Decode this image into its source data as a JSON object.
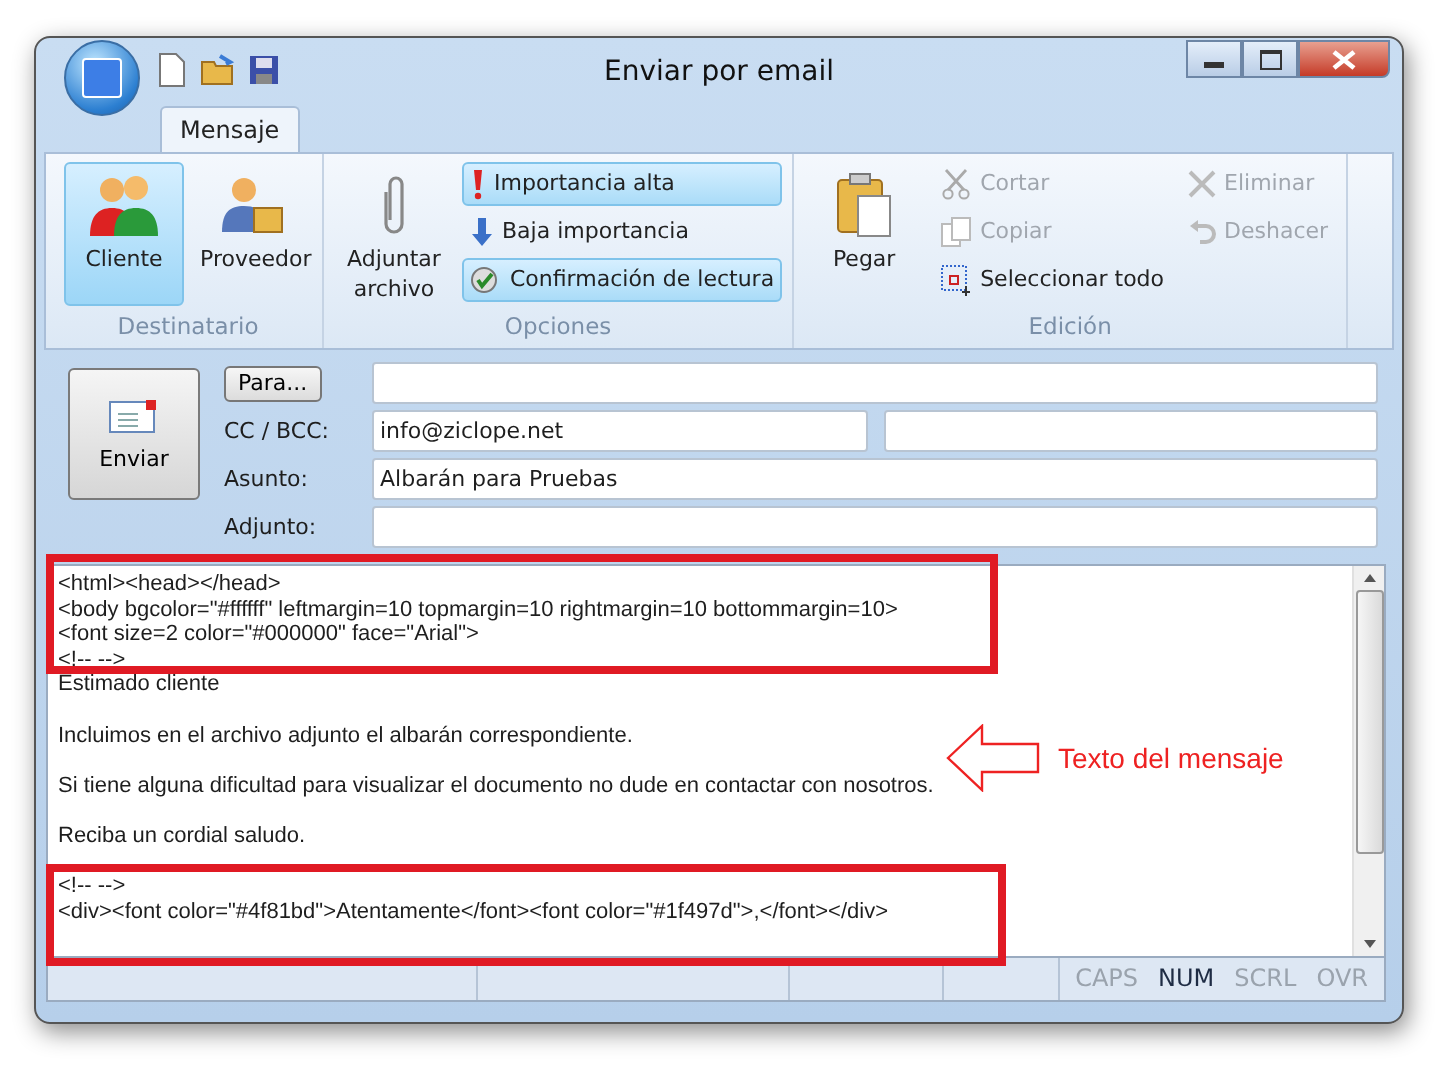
{
  "window": {
    "title": "Enviar por email"
  },
  "tabs": [
    {
      "label": "Mensaje",
      "selected": true
    }
  ],
  "ribbon": {
    "groups": [
      {
        "label": "Destinatario",
        "items": [
          {
            "kind": "large",
            "label": "Cliente",
            "selected": true
          },
          {
            "kind": "large",
            "label": "Proveedor",
            "selected": false
          }
        ]
      },
      {
        "label": "Opciones",
        "items": [
          {
            "kind": "large",
            "label": "Adjuntar archivo",
            "selected": false
          },
          {
            "kind": "stack",
            "items": [
              {
                "label": "Importancia alta",
                "selected": true
              },
              {
                "label": "Baja importancia",
                "selected": false
              },
              {
                "label": "Confirmación de lectura",
                "selected": true
              }
            ]
          }
        ]
      },
      {
        "label": "Edición",
        "items": [
          {
            "kind": "large",
            "label": "Pegar",
            "selected": false
          },
          {
            "kind": "stack",
            "items": [
              {
                "label": "Cortar",
                "disabled": true
              },
              {
                "label": "Copiar",
                "disabled": true
              },
              {
                "label": "Seleccionar todo",
                "disabled": false
              }
            ]
          },
          {
            "kind": "stack",
            "items": [
              {
                "label": "Eliminar",
                "disabled": true
              },
              {
                "label": "Deshacer",
                "disabled": true
              }
            ]
          }
        ]
      }
    ]
  },
  "header": {
    "send_button": "Enviar",
    "to_button": "Para...",
    "cc_label": "CC / BCC:",
    "cc_value": "info@ziclope.net",
    "subject_label": "Asunto:",
    "subject_value": "Albarán para Pruebas",
    "attachment_label": "Adjunto:"
  },
  "body": {
    "blocks": [
      [
        "<html><head></head>",
        "<body bgcolor=\"#ffffff\" leftmargin=10 topmargin=10 rightmargin=10 bottommargin=10>",
        "<font size=2 color=\"#000000\" face=\"Arial\">",
        "<!-- -->",
        "Estimado cliente"
      ],
      [
        "Incluimos en el archivo adjunto el albarán correspondiente."
      ],
      [
        "Si tiene alguna dificultad para visualizar el documento no dude en contactar con nosotros."
      ],
      [
        "Reciba un cordial saludo."
      ],
      [
        "<!-- -->",
        "<div><font color=\"#4f81bd\">Atentamente</font><font color=\"#1f497d\">,</font></div>"
      ]
    ]
  },
  "annotation": {
    "label": "Texto del mensaje"
  },
  "status_bar": {
    "indicators": [
      {
        "label": "CAPS",
        "on": false
      },
      {
        "label": "NUM",
        "on": true
      },
      {
        "label": "SCRL",
        "on": false
      },
      {
        "label": "OVR",
        "on": false
      }
    ]
  }
}
